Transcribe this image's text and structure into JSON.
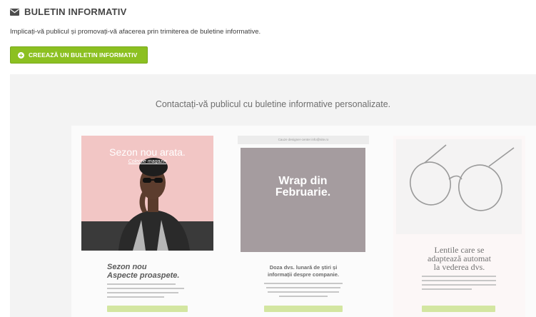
{
  "header": {
    "icon": "envelope-icon",
    "title": "BULETIN INFORMATIV"
  },
  "description": "Implicați-vă publicul și promovați-vă afacerea prin trimiterea de buletine informative.",
  "create_button": {
    "icon": "plus-circle-icon",
    "label": "CREEAZĂ UN BULETIN INFORMATIV",
    "color": "#8cc021"
  },
  "promo": {
    "text": "Contactați-vă publicul cu buletine informative personalizate."
  },
  "templates": [
    {
      "image_title": "Sezon nou arata.",
      "image_subtitle": "Colectie magazin",
      "heading_lines": [
        "Sezon nou",
        "Aspecte proaspete."
      ],
      "image_color": "#f2c6c5"
    },
    {
      "top_bar": "Cauze designer-center  info@site.ro",
      "image_title_lines": [
        "Wrap din",
        "Februarie."
      ],
      "heading_lines": [
        "Doza dvs. lunară de știri și",
        "informații despre companie."
      ],
      "image_color": "#a59c9f"
    },
    {
      "image": "eyeglasses",
      "heading_lines": [
        "Lentile care se",
        "adaptează automat",
        "la vederea dvs."
      ]
    }
  ]
}
